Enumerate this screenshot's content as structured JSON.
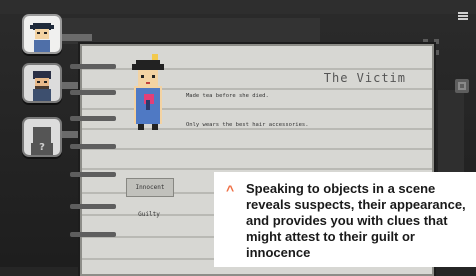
{
  "header": {
    "menu_icon": "hamburger-icon",
    "close_icon": "cross-icon",
    "side_icon": "book-icon"
  },
  "suspects": [
    {
      "name": "suspect-woman",
      "selected": true
    },
    {
      "name": "suspect-man",
      "selected": false
    },
    {
      "name": "suspect-unknown",
      "selected": false,
      "glyph": "?"
    }
  ],
  "notebook": {
    "title": "The Victim",
    "clues": [
      "Made tea before she died.",
      "Only wears the best hair accessories."
    ],
    "choices": {
      "innocent": "Innocent",
      "guilty": "Guilty"
    }
  },
  "caption": {
    "text": "Speaking to objects in a scene reveals suspects, their appearance, and provides you with clues that might attest to their guilt or innocence"
  },
  "colors": {
    "accent": "#ef6f45",
    "paper": "#d7d7d3",
    "background": "#262626"
  }
}
